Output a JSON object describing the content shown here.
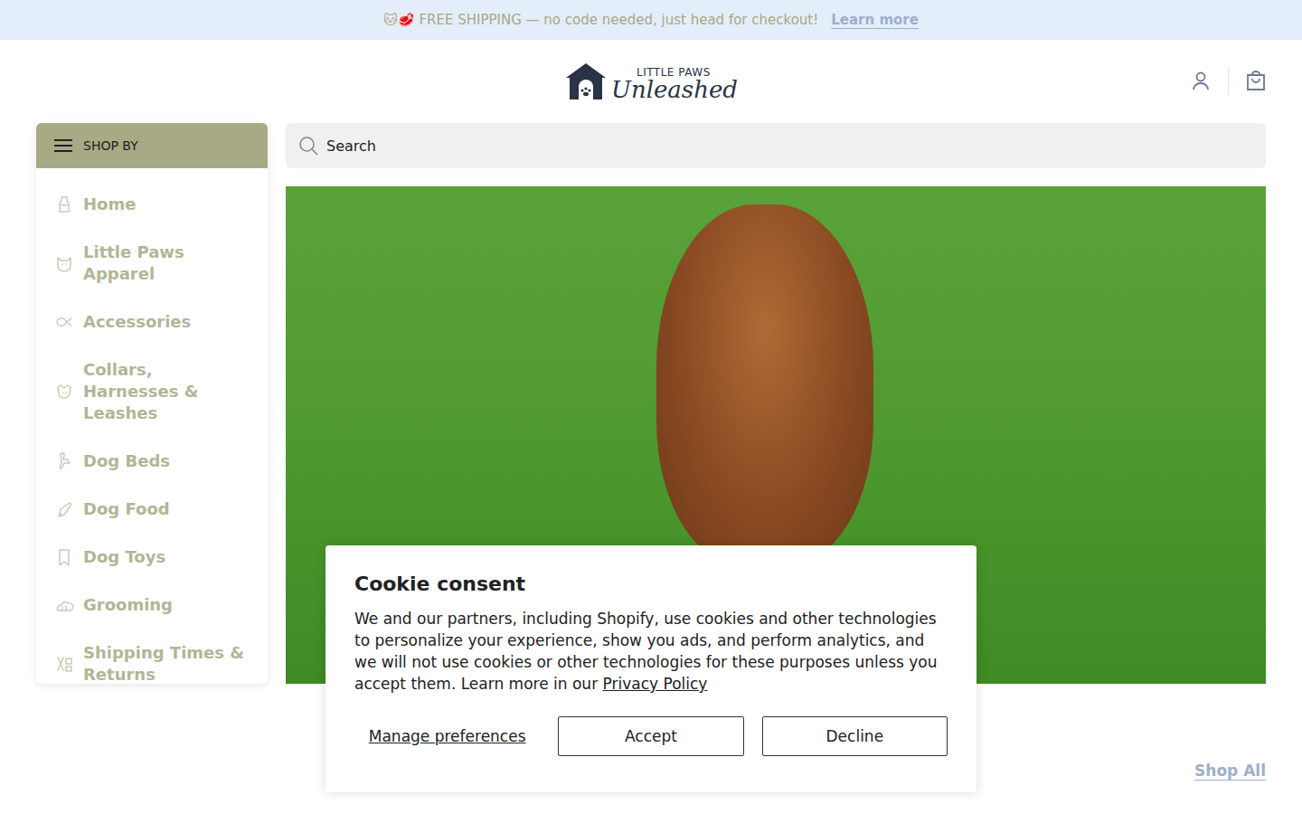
{
  "announcement": {
    "icons": "🐱🥩",
    "text": "FREE SHIPPING — no code needed, just head for checkout!",
    "link": "Learn more"
  },
  "header": {
    "logo": {
      "top": "LITTLE PAWS",
      "script": "Unleashed"
    }
  },
  "sidebar": {
    "title": "SHOP BY",
    "items": [
      {
        "label": "Home"
      },
      {
        "label": "Little Paws Apparel"
      },
      {
        "label": "Accessories"
      },
      {
        "label": "Collars, Harnesses & Leashes"
      },
      {
        "label": "Dog Beds"
      },
      {
        "label": "Dog Food"
      },
      {
        "label": "Dog Toys"
      },
      {
        "label": "Grooming"
      },
      {
        "label": "Shipping Times & Returns"
      }
    ]
  },
  "search": {
    "placeholder": "Search"
  },
  "section": {
    "link": "Shop All"
  },
  "cookie": {
    "title": "Cookie consent",
    "body": "We and our partners, including Shopify, use cookies and other technologies to personalize your experience, show you ads, and perform analytics, and we will not use cookies or other technologies for these purposes unless you accept them. Learn more in our",
    "link": "Privacy Policy",
    "buttons": [
      "Manage preferences",
      "Accept",
      "Decline"
    ]
  }
}
